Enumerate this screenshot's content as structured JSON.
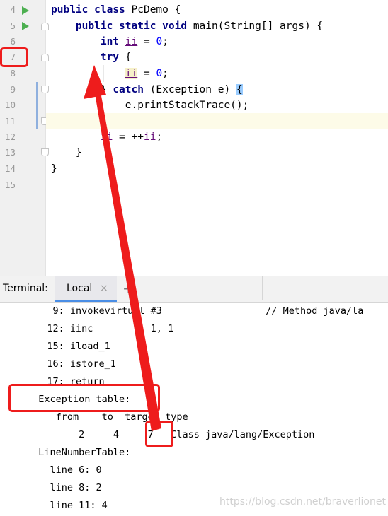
{
  "editor": {
    "line_numbers": [
      "4",
      "5",
      "6",
      "7",
      "8",
      "9",
      "10",
      "11",
      "12",
      "13",
      "14",
      "15"
    ],
    "lines": [
      {
        "id": "l4",
        "text": "public class PcDemo {"
      },
      {
        "id": "l5",
        "text": "    public static void main(String[] args) {"
      },
      {
        "id": "l6",
        "text": "        int ii = 0;"
      },
      {
        "id": "l7",
        "text": "        try {"
      },
      {
        "id": "l8",
        "text": "            ii = 0;"
      },
      {
        "id": "l9",
        "text": "        } catch (Exception e) {"
      },
      {
        "id": "l10",
        "text": "            e.printStackTrace();"
      },
      {
        "id": "l11",
        "text": ""
      },
      {
        "id": "l12",
        "text": "        ii = ++ii;"
      },
      {
        "id": "l13",
        "text": "    }"
      },
      {
        "id": "l14",
        "text": "}"
      },
      {
        "id": "l15",
        "text": ""
      }
    ],
    "tokens": {
      "public": "public",
      "class": "class",
      "class_name": "PcDemo {",
      "static": "static",
      "void": "void",
      "main_sig": "main(String[] args) {",
      "int": "int",
      "ii": "ii",
      "eq_zero": " = 0;",
      "try": "try",
      "open_brace": " {",
      "close_brace": "}",
      "catch": "catch",
      "exception": "(Exception e)",
      "brace_hl": "{",
      "print": "e.printStackTrace();",
      "assign": " = ++",
      "semi": ";",
      "zero": "0"
    }
  },
  "terminal": {
    "title": "Terminal:",
    "tab_label": "Local",
    "close_glyph": "×",
    "add_glyph": "+",
    "lines": [
      "    9: invokevirtual #3                  // Method java/la",
      "   12: iinc          1, 1",
      "   15: iload_1",
      "   16: istore_1",
      "   17: return",
      "  Exception table:",
      "     from    to  target type",
      "         2     4     7   Class java/lang/Exception",
      "  LineNumberTable:",
      "    line 6: 0",
      "    line 8: 2",
      "    line 11: 4"
    ]
  },
  "watermark": "https://blog.csdn.net/braverlionet",
  "colors": {
    "keyword": "#000080",
    "number": "#0000ff",
    "variable": "#660e7a",
    "annotation": "#ee1c1c",
    "run_icon": "#4caf50",
    "tab_underline": "#4a8ee6"
  }
}
